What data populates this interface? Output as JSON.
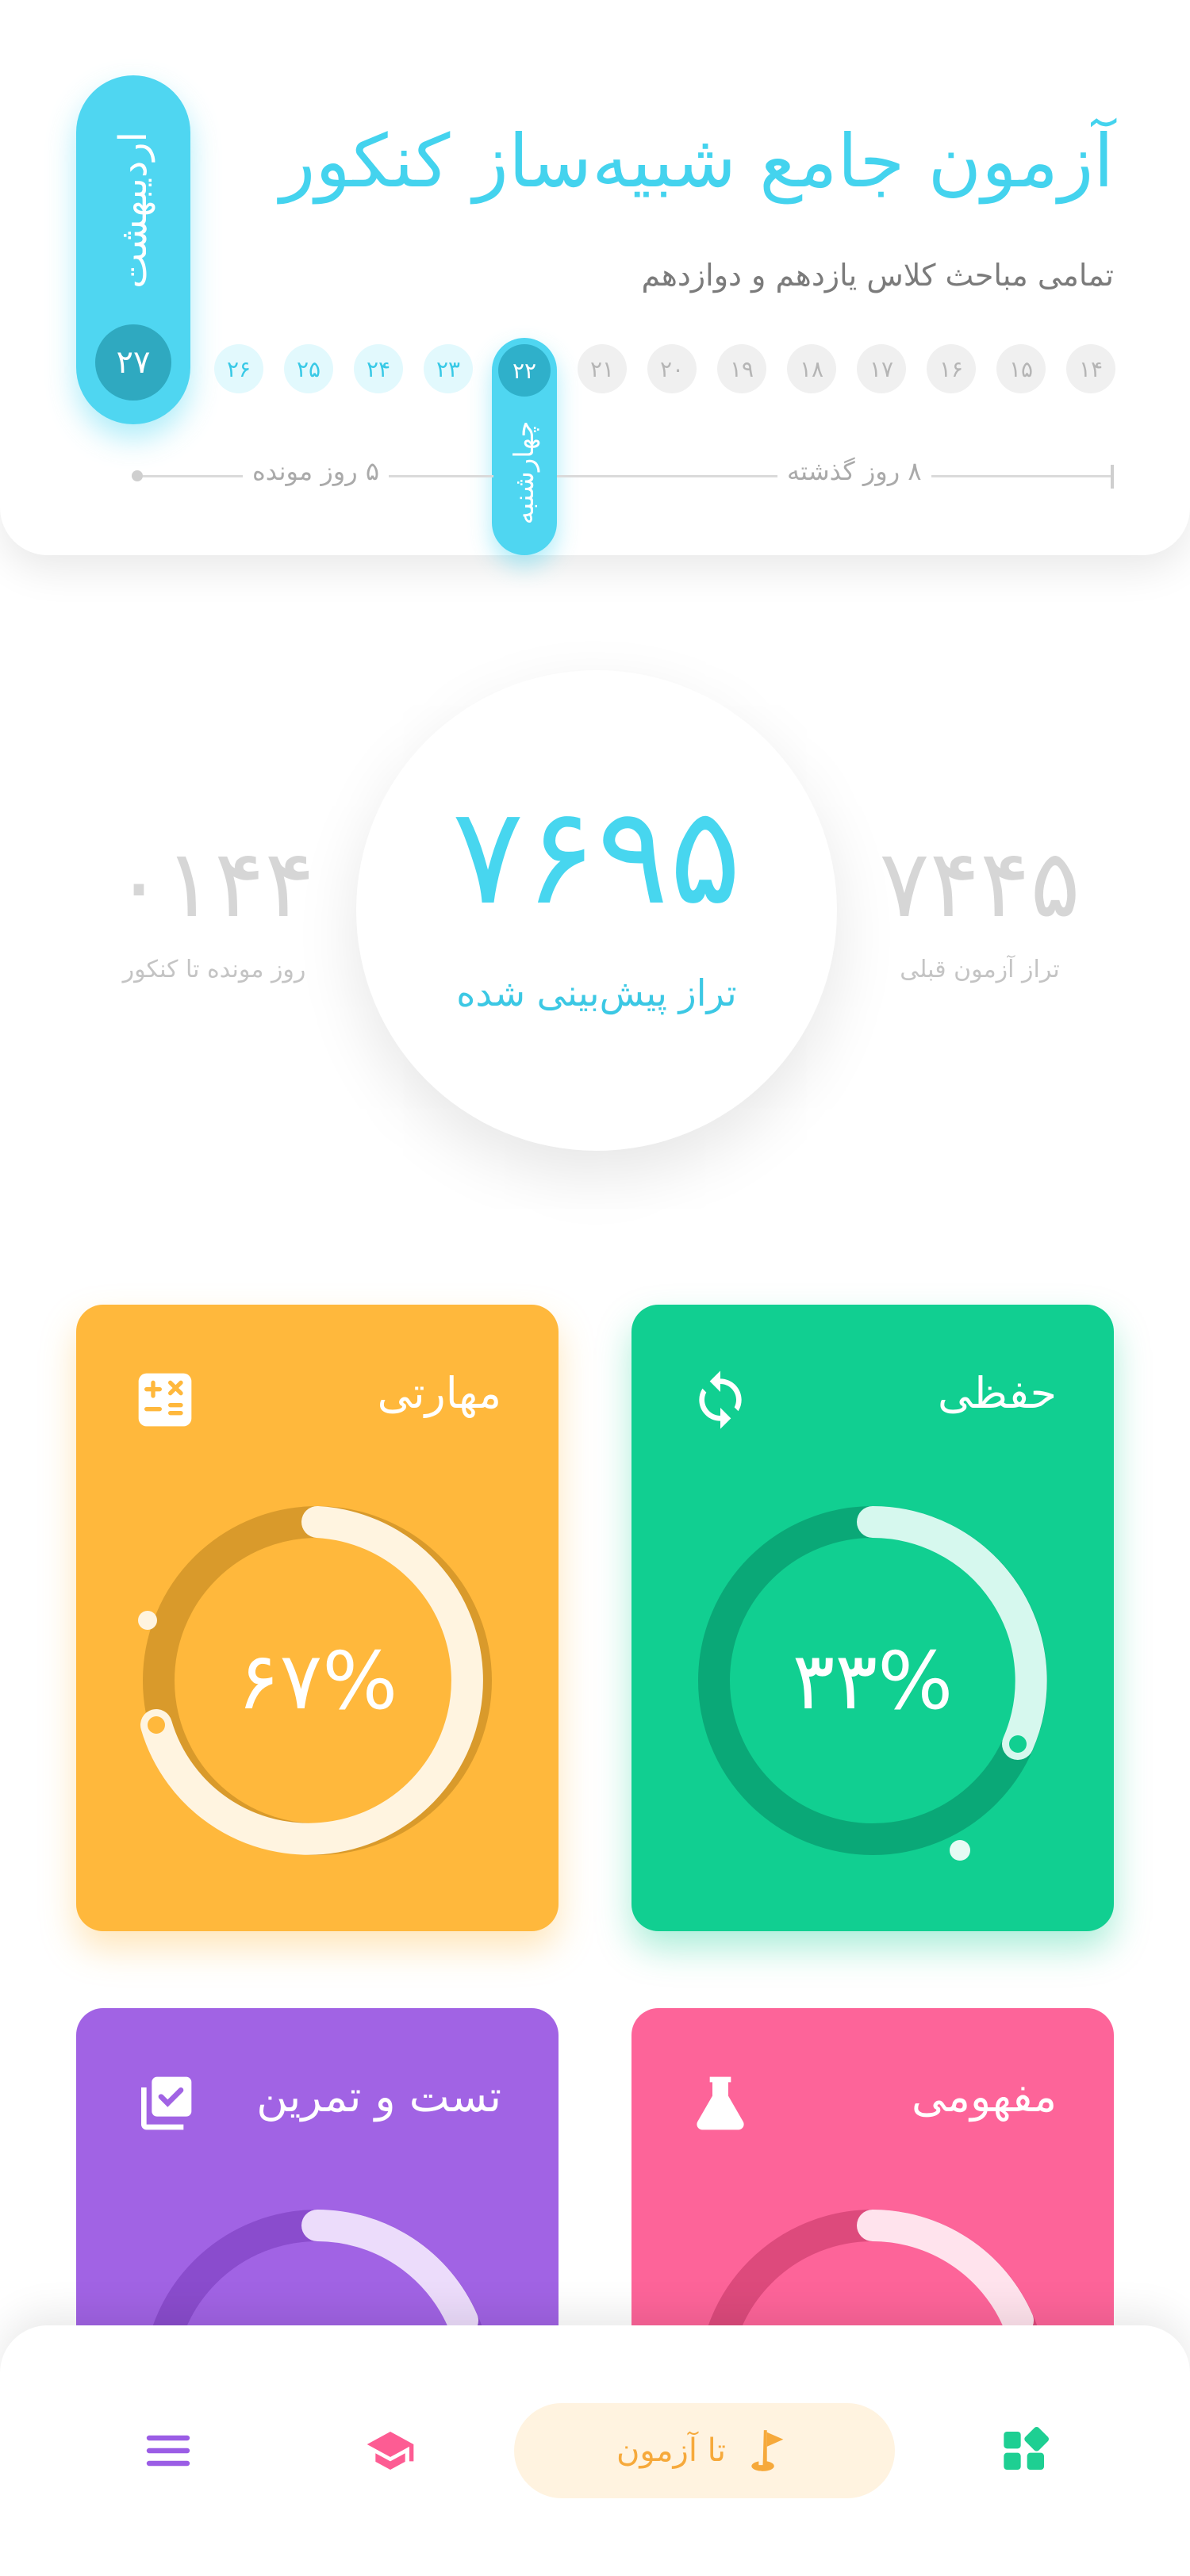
{
  "header": {
    "title": "آزمون جامع شبیه‌ساز کنکور",
    "subtitle": "تمامی مباحث کلاس یازدهم و دوازدهم",
    "month": "اردیبهشت",
    "exam_day": "۲۷",
    "today": {
      "day": "۲۲",
      "weekday": "چهارشنبه"
    },
    "past_days": [
      "۱۴",
      "۱۵",
      "۱۶",
      "۱۷",
      "۱۸",
      "۱۹",
      "۲۰",
      "۲۱"
    ],
    "future_days": [
      "۲۳",
      "۲۴",
      "۲۵",
      "۲۶"
    ],
    "days_passed_label": "۸ روز گذشته",
    "days_left_label": "۵ روز مونده"
  },
  "score": {
    "predicted_value": "۷۶۹۵",
    "predicted_label": "تراز پیش‌بینی شده",
    "previous_value": "۷۴۴۵",
    "previous_label": "تراز آزمون قبلی",
    "days_to_konkur_value": "۰۱۴۴",
    "days_to_konkur_label": "روز مونده تا کنکور"
  },
  "categories": [
    {
      "title": "حفظی",
      "percent_text": "۳۳%",
      "percent": 33,
      "color": "#11cf91",
      "icon": "refresh-icon"
    },
    {
      "title": "مهارتی",
      "percent_text": "۶۷%",
      "percent": 67,
      "color": "#ffb83c",
      "icon": "calculator-icon"
    },
    {
      "title": "مفهومی",
      "color": "#fd6499",
      "icon": "flask-icon"
    },
    {
      "title": "تست و تمرین",
      "color": "#a163e4",
      "icon": "checklist-icon"
    }
  ],
  "nav": {
    "exam_label": "تا آزمون",
    "colors": {
      "primary": "#47d6ef",
      "exam_pill": "#fff3e0",
      "exam_text": "#f6a93b"
    },
    "icons": [
      "grid-icon",
      "golf-flag-icon",
      "graduation-cap-icon",
      "menu-icon"
    ]
  }
}
